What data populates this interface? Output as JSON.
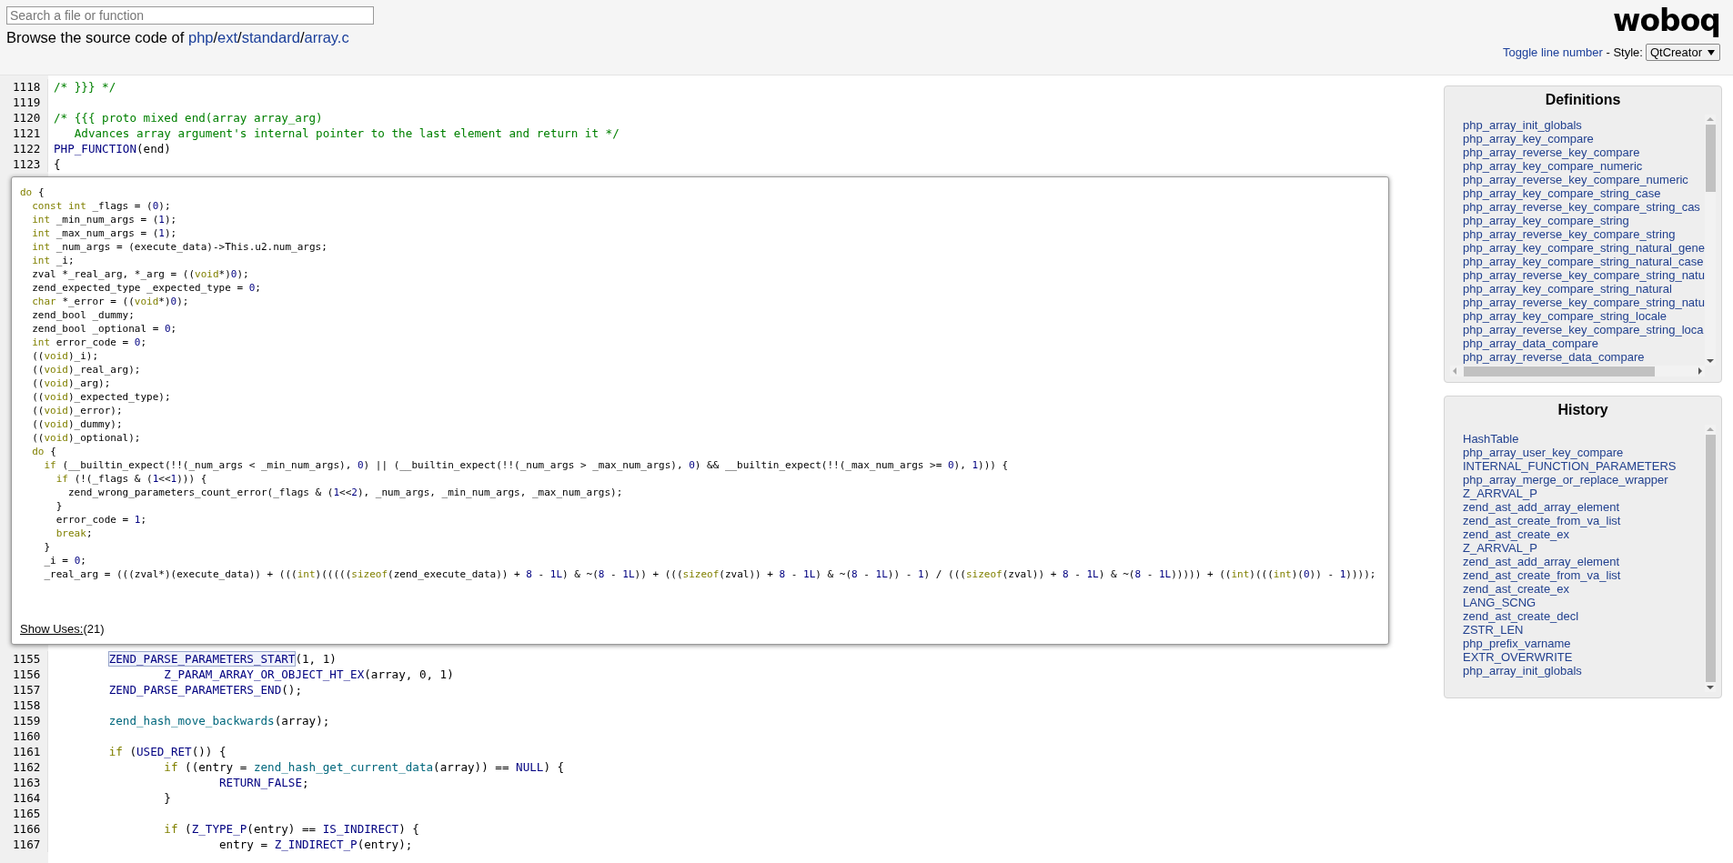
{
  "header": {
    "search": {
      "placeholder": "Search a file or function"
    },
    "breadcrumb": [
      {
        "kind": "text",
        "text": "Browse the source code of "
      },
      {
        "kind": "link",
        "text": "php"
      },
      {
        "kind": "sep",
        "text": "/"
      },
      {
        "kind": "link",
        "text": "ext"
      },
      {
        "kind": "sep",
        "text": "/"
      },
      {
        "kind": "link",
        "text": "standard"
      },
      {
        "kind": "sep",
        "text": "/"
      },
      {
        "kind": "link",
        "text": "array.c"
      }
    ],
    "logo": "woboq",
    "toggle_link": "Toggle line number",
    "style_label": " - Style:",
    "style_select": {
      "value": "QtCreator"
    }
  },
  "code": {
    "lines_before": [
      {
        "n": "1118",
        "code": [
          {
            "kind": "com",
            "text": "/* }}} */"
          }
        ]
      },
      {
        "n": "1119"
      },
      {
        "n": "1120",
        "code": [
          {
            "kind": "com",
            "text": "/* {{{ proto mixed end(array array_arg)"
          }
        ]
      },
      {
        "n": "1121",
        "code": [
          {
            "kind": "com",
            "text": "   Advances array argument's internal pointer to the last element and return it */"
          }
        ]
      },
      {
        "n": "1122",
        "code": [
          {
            "kind": "mac",
            "text": "PHP_FUNCTION"
          },
          {
            "kind": "p",
            "text": "(end)"
          }
        ]
      },
      {
        "n": "1123",
        "code": [
          {
            "kind": "p",
            "text": "{"
          }
        ]
      }
    ],
    "tooltip": {
      "lines": [
        [
          {
            "kind": "kw",
            "text": "do"
          },
          {
            "kind": "p",
            "text": " {"
          }
        ],
        [
          {
            "kind": "kw",
            "text": "  const int"
          },
          {
            "kind": "p",
            "text": " _flags = ("
          },
          {
            "kind": "num",
            "text": "0"
          },
          {
            "kind": "p",
            "text": ");"
          }
        ],
        [
          {
            "kind": "kw",
            "text": "  int"
          },
          {
            "kind": "p",
            "text": " _min_num_args = ("
          },
          {
            "kind": "num",
            "text": "1"
          },
          {
            "kind": "p",
            "text": ");"
          }
        ],
        [
          {
            "kind": "kw",
            "text": "  int"
          },
          {
            "kind": "p",
            "text": " _max_num_args = ("
          },
          {
            "kind": "num",
            "text": "1"
          },
          {
            "kind": "p",
            "text": ");"
          }
        ],
        [
          {
            "kind": "kw",
            "text": "  int"
          },
          {
            "kind": "p",
            "text": " _num_args = (execute_data)->This.u2.num_args;"
          }
        ],
        [
          {
            "kind": "kw",
            "text": "  int"
          },
          {
            "kind": "p",
            "text": " _i;"
          }
        ],
        [
          {
            "kind": "p",
            "text": "  zval *_real_arg, *_arg = (("
          },
          {
            "kind": "kw",
            "text": "void"
          },
          {
            "kind": "p",
            "text": "*)"
          },
          {
            "kind": "num",
            "text": "0"
          },
          {
            "kind": "p",
            "text": ");"
          }
        ],
        [
          {
            "kind": "p",
            "text": "  zend_expected_type _expected_type = "
          },
          {
            "kind": "num",
            "text": "0"
          },
          {
            "kind": "p",
            "text": ";"
          }
        ],
        [
          {
            "kind": "kw",
            "text": "  char"
          },
          {
            "kind": "p",
            "text": " *_error = (("
          },
          {
            "kind": "kw",
            "text": "void"
          },
          {
            "kind": "p",
            "text": "*)"
          },
          {
            "kind": "num",
            "text": "0"
          },
          {
            "kind": "p",
            "text": ");"
          }
        ],
        [
          {
            "kind": "p",
            "text": "  zend_bool _dummy;"
          }
        ],
        [
          {
            "kind": "p",
            "text": "  zend_bool _optional = "
          },
          {
            "kind": "num",
            "text": "0"
          },
          {
            "kind": "p",
            "text": ";"
          }
        ],
        [
          {
            "kind": "kw",
            "text": "  int"
          },
          {
            "kind": "p",
            "text": " error_code = "
          },
          {
            "kind": "num",
            "text": "0"
          },
          {
            "kind": "p",
            "text": ";"
          }
        ],
        [
          {
            "kind": "p",
            "text": "  (("
          },
          {
            "kind": "kw",
            "text": "void"
          },
          {
            "kind": "p",
            "text": ")_i);"
          }
        ],
        [
          {
            "kind": "p",
            "text": "  (("
          },
          {
            "kind": "kw",
            "text": "void"
          },
          {
            "kind": "p",
            "text": ")_real_arg);"
          }
        ],
        [
          {
            "kind": "p",
            "text": "  (("
          },
          {
            "kind": "kw",
            "text": "void"
          },
          {
            "kind": "p",
            "text": ")_arg);"
          }
        ],
        [
          {
            "kind": "p",
            "text": "  (("
          },
          {
            "kind": "kw",
            "text": "void"
          },
          {
            "kind": "p",
            "text": ")_expected_type);"
          }
        ],
        [
          {
            "kind": "p",
            "text": "  (("
          },
          {
            "kind": "kw",
            "text": "void"
          },
          {
            "kind": "p",
            "text": ")_error);"
          }
        ],
        [
          {
            "kind": "p",
            "text": "  (("
          },
          {
            "kind": "kw",
            "text": "void"
          },
          {
            "kind": "p",
            "text": ")_dummy);"
          }
        ],
        [
          {
            "kind": "p",
            "text": "  (("
          },
          {
            "kind": "kw",
            "text": "void"
          },
          {
            "kind": "p",
            "text": ")_optional);"
          }
        ],
        [
          {
            "kind": "kw",
            "text": "  do"
          },
          {
            "kind": "p",
            "text": " {"
          }
        ],
        [
          {
            "kind": "kw",
            "text": "    if"
          },
          {
            "kind": "p",
            "text": " (__builtin_expect(!!(_num_args < _min_num_args), "
          },
          {
            "kind": "num",
            "text": "0"
          },
          {
            "kind": "p",
            "text": ") || (__builtin_expect(!!(_num_args > _max_num_args), "
          },
          {
            "kind": "num",
            "text": "0"
          },
          {
            "kind": "p",
            "text": ") && __builtin_expect(!!(_max_num_args >= "
          },
          {
            "kind": "num",
            "text": "0"
          },
          {
            "kind": "p",
            "text": "), "
          },
          {
            "kind": "num",
            "text": "1"
          },
          {
            "kind": "p",
            "text": "))) {"
          }
        ],
        [
          {
            "kind": "kw",
            "text": "      if"
          },
          {
            "kind": "p",
            "text": " (!(_flags & ("
          },
          {
            "kind": "num",
            "text": "1"
          },
          {
            "kind": "p",
            "text": "<<"
          },
          {
            "kind": "num",
            "text": "1"
          },
          {
            "kind": "p",
            "text": "))) {"
          }
        ],
        [
          {
            "kind": "p",
            "text": "        zend_wrong_parameters_count_error(_flags & ("
          },
          {
            "kind": "num",
            "text": "1"
          },
          {
            "kind": "p",
            "text": "<<"
          },
          {
            "kind": "num",
            "text": "2"
          },
          {
            "kind": "p",
            "text": "), _num_args, _min_num_args, _max_num_args);"
          }
        ],
        [
          {
            "kind": "p",
            "text": "      }"
          }
        ],
        [
          {
            "kind": "p",
            "text": "      error_code = "
          },
          {
            "kind": "num",
            "text": "1"
          },
          {
            "kind": "p",
            "text": ";"
          }
        ],
        [
          {
            "kind": "kw",
            "text": "      break"
          },
          {
            "kind": "p",
            "text": ";"
          }
        ],
        [
          {
            "kind": "p",
            "text": "    }"
          }
        ],
        [
          {
            "kind": "p",
            "text": "    _i = "
          },
          {
            "kind": "num",
            "text": "0"
          },
          {
            "kind": "p",
            "text": ";"
          }
        ],
        [
          {
            "kind": "p",
            "text": "    _real_arg = (((zval*)(execute_data)) + ((("
          },
          {
            "kind": "kw",
            "text": "int"
          },
          {
            "kind": "p",
            "text": ")((((("
          },
          {
            "kind": "kw",
            "text": "sizeof"
          },
          {
            "kind": "p",
            "text": "(zend_execute_data)) + "
          },
          {
            "kind": "num",
            "text": "8"
          },
          {
            "kind": "p",
            "text": " - "
          },
          {
            "kind": "num",
            "text": "1L"
          },
          {
            "kind": "p",
            "text": ") & ~("
          },
          {
            "kind": "num",
            "text": "8"
          },
          {
            "kind": "p",
            "text": " - "
          },
          {
            "kind": "num",
            "text": "1L"
          },
          {
            "kind": "p",
            "text": ")) + ((("
          },
          {
            "kind": "kw",
            "text": "sizeof"
          },
          {
            "kind": "p",
            "text": "(zval)) + "
          },
          {
            "kind": "num",
            "text": "8"
          },
          {
            "kind": "p",
            "text": " - "
          },
          {
            "kind": "num",
            "text": "1L"
          },
          {
            "kind": "p",
            "text": ") & ~("
          },
          {
            "kind": "num",
            "text": "8"
          },
          {
            "kind": "p",
            "text": " - "
          },
          {
            "kind": "num",
            "text": "1L"
          },
          {
            "kind": "p",
            "text": ")) - "
          },
          {
            "kind": "num",
            "text": "1"
          },
          {
            "kind": "p",
            "text": ") / ((("
          },
          {
            "kind": "kw",
            "text": "sizeof"
          },
          {
            "kind": "p",
            "text": "(zval)) + "
          },
          {
            "kind": "num",
            "text": "8"
          },
          {
            "kind": "p",
            "text": " - "
          },
          {
            "kind": "num",
            "text": "1L"
          },
          {
            "kind": "p",
            "text": ") & ~("
          },
          {
            "kind": "num",
            "text": "8"
          },
          {
            "kind": "p",
            "text": " - "
          },
          {
            "kind": "num",
            "text": "1L"
          },
          {
            "kind": "p",
            "text": "))))) + (("
          },
          {
            "kind": "kw",
            "text": "int"
          },
          {
            "kind": "p",
            "text": ")((("
          },
          {
            "kind": "kw",
            "text": "int"
          },
          {
            "kind": "p",
            "text": ")("
          },
          {
            "kind": "num",
            "text": "0"
          },
          {
            "kind": "p",
            "text": ")) - "
          },
          {
            "kind": "num",
            "text": "1"
          },
          {
            "kind": "p",
            "text": "))));"
          }
        ]
      ],
      "show_uses": {
        "link": "Show Uses:",
        "count": "(21)"
      }
    },
    "lines_after": [
      {
        "n": "1155",
        "code": [
          {
            "kind": "mac-hover",
            "text": "        ZEND_PARSE_PARAMETERS_START"
          },
          {
            "kind": "p",
            "text": "(1, 1)"
          }
        ]
      },
      {
        "n": "1156",
        "code": [
          {
            "kind": "mac",
            "text": "                Z_PARAM_ARRAY_OR_OBJECT_HT_EX"
          },
          {
            "kind": "p",
            "text": "(array, 0, 1)"
          }
        ]
      },
      {
        "n": "1157",
        "code": [
          {
            "kind": "mac",
            "text": "        ZEND_PARSE_PARAMETERS_END"
          },
          {
            "kind": "p",
            "text": "();"
          }
        ]
      },
      {
        "n": "1158"
      },
      {
        "n": "1159",
        "code": [
          {
            "kind": "fn",
            "text": "        zend_hash_move_backwards"
          },
          {
            "kind": "p",
            "text": "(array);"
          }
        ]
      },
      {
        "n": "1160"
      },
      {
        "n": "1161",
        "code": [
          {
            "kind": "kw",
            "text": "        if"
          },
          {
            "kind": "p",
            "text": " ("
          },
          {
            "kind": "mac",
            "text": "USED_RET"
          },
          {
            "kind": "p",
            "text": "()) {"
          }
        ]
      },
      {
        "n": "1162",
        "code": [
          {
            "kind": "kw",
            "text": "                if"
          },
          {
            "kind": "p",
            "text": " ((entry = "
          },
          {
            "kind": "fn",
            "text": "zend_hash_get_current_data"
          },
          {
            "kind": "p",
            "text": "(array)) == "
          },
          {
            "kind": "mac",
            "text": "NULL"
          },
          {
            "kind": "p",
            "text": ") {"
          }
        ]
      },
      {
        "n": "1163",
        "code": [
          {
            "kind": "mac",
            "text": "                        RETURN_FALSE"
          },
          {
            "kind": "p",
            "text": ";"
          }
        ]
      },
      {
        "n": "1164",
        "code": [
          {
            "kind": "p",
            "text": "                }"
          }
        ]
      },
      {
        "n": "1165"
      },
      {
        "n": "1166",
        "code": [
          {
            "kind": "kw",
            "text": "                if"
          },
          {
            "kind": "p",
            "text": " ("
          },
          {
            "kind": "mac",
            "text": "Z_TYPE_P"
          },
          {
            "kind": "p",
            "text": "(entry) == "
          },
          {
            "kind": "mac",
            "text": "IS_INDIRECT"
          },
          {
            "kind": "p",
            "text": ") {"
          }
        ]
      },
      {
        "n": "1167",
        "code": [
          {
            "kind": "p",
            "text": "                        entry = "
          },
          {
            "kind": "mac",
            "text": "Z_INDIRECT_P"
          },
          {
            "kind": "p",
            "text": "(entry);"
          }
        ]
      }
    ]
  },
  "sidebar": {
    "definitions": {
      "title": "Definitions",
      "items": [
        "php_array_init_globals",
        "php_array_key_compare",
        "php_array_reverse_key_compare",
        "php_array_key_compare_numeric",
        "php_array_reverse_key_compare_numeric",
        "php_array_key_compare_string_case",
        "php_array_reverse_key_compare_string_cas",
        "php_array_key_compare_string",
        "php_array_reverse_key_compare_string",
        "php_array_key_compare_string_natural_gene",
        "php_array_key_compare_string_natural_case",
        "php_array_reverse_key_compare_string_natu",
        "php_array_key_compare_string_natural",
        "php_array_reverse_key_compare_string_natu",
        "php_array_key_compare_string_locale",
        "php_array_reverse_key_compare_string_loca",
        "php_array_data_compare",
        "php_array_reverse_data_compare"
      ]
    },
    "history": {
      "title": "History",
      "items": [
        "HashTable",
        "php_array_user_key_compare",
        "INTERNAL_FUNCTION_PARAMETERS",
        "php_array_merge_or_replace_wrapper",
        "Z_ARRVAL_P",
        "zend_ast_add_array_element",
        "zend_ast_create_from_va_list",
        "zend_ast_create_ex",
        "Z_ARRVAL_P",
        "zend_ast_add_array_element",
        "zend_ast_create_from_va_list",
        "zend_ast_create_ex",
        "LANG_SCNG",
        "zend_ast_create_decl",
        "ZSTR_LEN",
        "php_prefix_varname",
        "EXTR_OVERWRITE",
        "php_array_init_globals"
      ]
    }
  }
}
